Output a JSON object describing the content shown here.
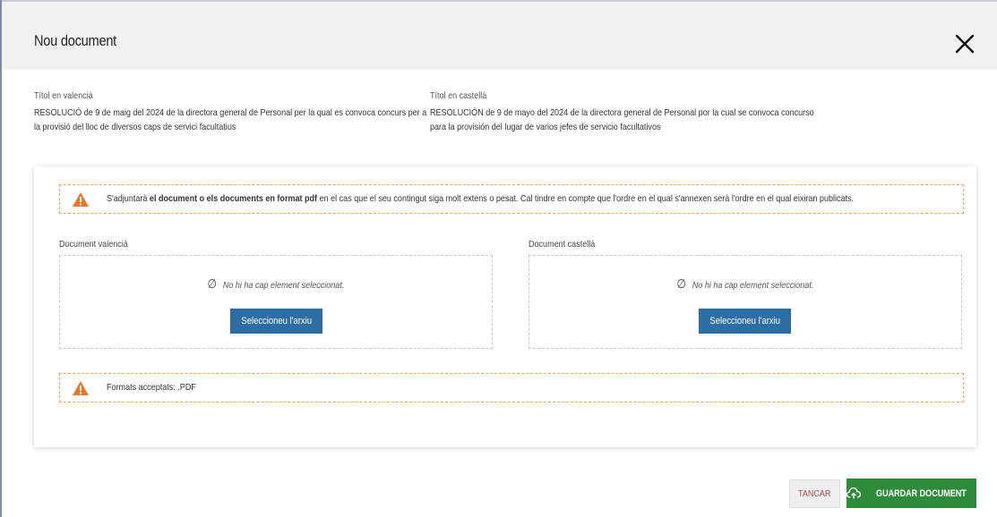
{
  "modal": {
    "title": "Nou document"
  },
  "titles": {
    "valencia_label": "Títol en valencià",
    "valencia_text": "RESOLUCIÓ de 9 de maig del 2024 de la directora general de Personal per la qual es convoca concurs per a la provisió del lloc de diversos caps de servici facultatius",
    "castella_label": "Títol en castellà",
    "castella_text": "RESOLUCIÓN de 9 de mayo del 2024 de la directora general de Personal por la cual se convoca concurso para la provisión del lugar de varios jefes de servicio facultativos"
  },
  "notice_top": {
    "before": "S'adjuntarà ",
    "bold": "el document o els documents en format pdf",
    "after": " en el cas que el seu contingut siga molt extens o pesat. Cal tindre en compte que l'ordre en el qual s'annexen serà l'ordre en el qual eixiran publicats."
  },
  "documents": {
    "valencia_label": "Document valencià",
    "castella_label": "Document castellà",
    "empty_message": "No hi ha cap element seleccionat.",
    "select_button": "Seleccioneu l'arxiu"
  },
  "notice_bottom": {
    "text": "Formats acceptats: .PDF"
  },
  "footer": {
    "cancel_label": "TANCAR",
    "save_label": "GUARDAR DOCUMENT"
  },
  "colors": {
    "primary_button": "#2e6da4",
    "save_button": "#2e8b3a",
    "warning": "#e8772e",
    "cancel_text": "#b04a4a"
  },
  "icons": {
    "close": "close-icon",
    "warning": "warning-icon",
    "empty": "empty-set-icon",
    "upload": "cloud-upload-icon"
  }
}
